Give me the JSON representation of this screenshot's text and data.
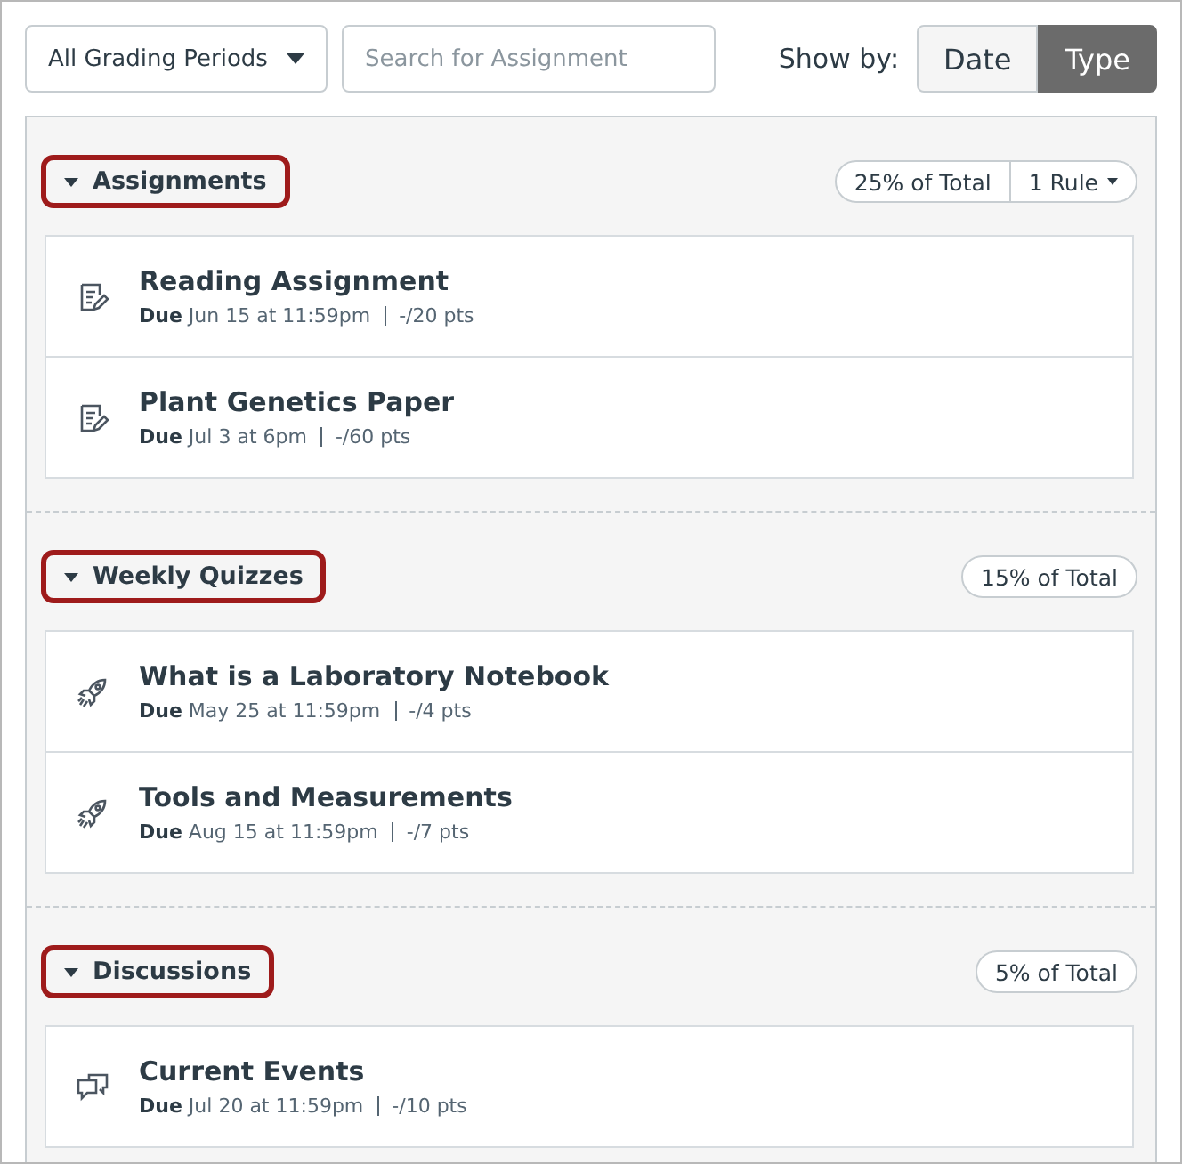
{
  "toolbar": {
    "period_select": "All Grading Periods",
    "search": {
      "placeholder": "Search for Assignment"
    },
    "show_by_label": "Show by:",
    "show_by": [
      {
        "label": "Date",
        "selected": false
      },
      {
        "label": "Type",
        "selected": true
      }
    ]
  },
  "groups": [
    {
      "name": "Assignments",
      "expanded": true,
      "highlighted": true,
      "weight": "25% of Total",
      "rule": "1 Rule",
      "items": [
        {
          "kind": "assignment",
          "title": "Reading Assignment",
          "due": "**Due** Jun 15 at 11:59pm",
          "points": "-/20 pts"
        },
        {
          "kind": "assignment",
          "title": "Plant Genetics Paper",
          "due": "**Due** Jul 3 at 6pm",
          "points": "-/60 pts"
        }
      ]
    },
    {
      "name": "Weekly Quizzes",
      "expanded": true,
      "highlighted": true,
      "weight": "15% of Total",
      "items": [
        {
          "kind": "quiz",
          "title": "What is a Laboratory Notebook",
          "due": "**Due** May 25 at 11:59pm",
          "points": "-/4 pts"
        },
        {
          "kind": "quiz",
          "title": "Tools and Measurements",
          "due": "**Due** Aug 15 at 11:59pm",
          "points": "-/7 pts"
        }
      ]
    },
    {
      "name": "Discussions",
      "expanded": true,
      "highlighted": true,
      "weight": "5% of Total",
      "items": [
        {
          "kind": "discussion",
          "title": "Current Events",
          "due": "**Due** Jul 20 at 11:59pm",
          "points": "-/10 pts"
        }
      ]
    }
  ]
}
